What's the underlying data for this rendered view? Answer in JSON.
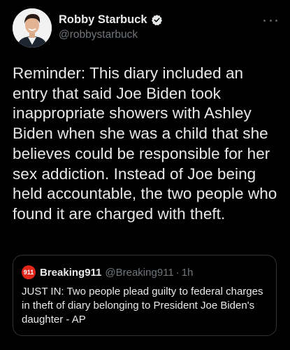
{
  "tweet": {
    "author": {
      "display_name": "Robby Starbuck",
      "handle": "@robbystarbuck",
      "verified": true,
      "avatar_icon": "profile-photo"
    },
    "more_icon": "ellipsis-icon",
    "text": "Reminder: This diary included an entry that said Joe Biden took inappropriate showers with Ashley Biden when she was a child that she believes could be responsible for her sex addiction. Instead of Joe being held accountable, the two people who found it are charged with theft.",
    "quoted": {
      "avatar_label": "911",
      "display_name": "Breaking911",
      "handle": "@Breaking911",
      "separator": "·",
      "time": "1h",
      "text": "JUST IN: Two people plead guilty to federal charges in theft of diary belonging to President Joe Biden's daughter - AP"
    }
  },
  "colors": {
    "background": "#000000",
    "primary_text": "#e7e9ea",
    "secondary_text": "#71767b",
    "verified_badge": "#e7e9ea",
    "quote_border": "#2f3336",
    "breaking911_red": "#e0261a"
  }
}
